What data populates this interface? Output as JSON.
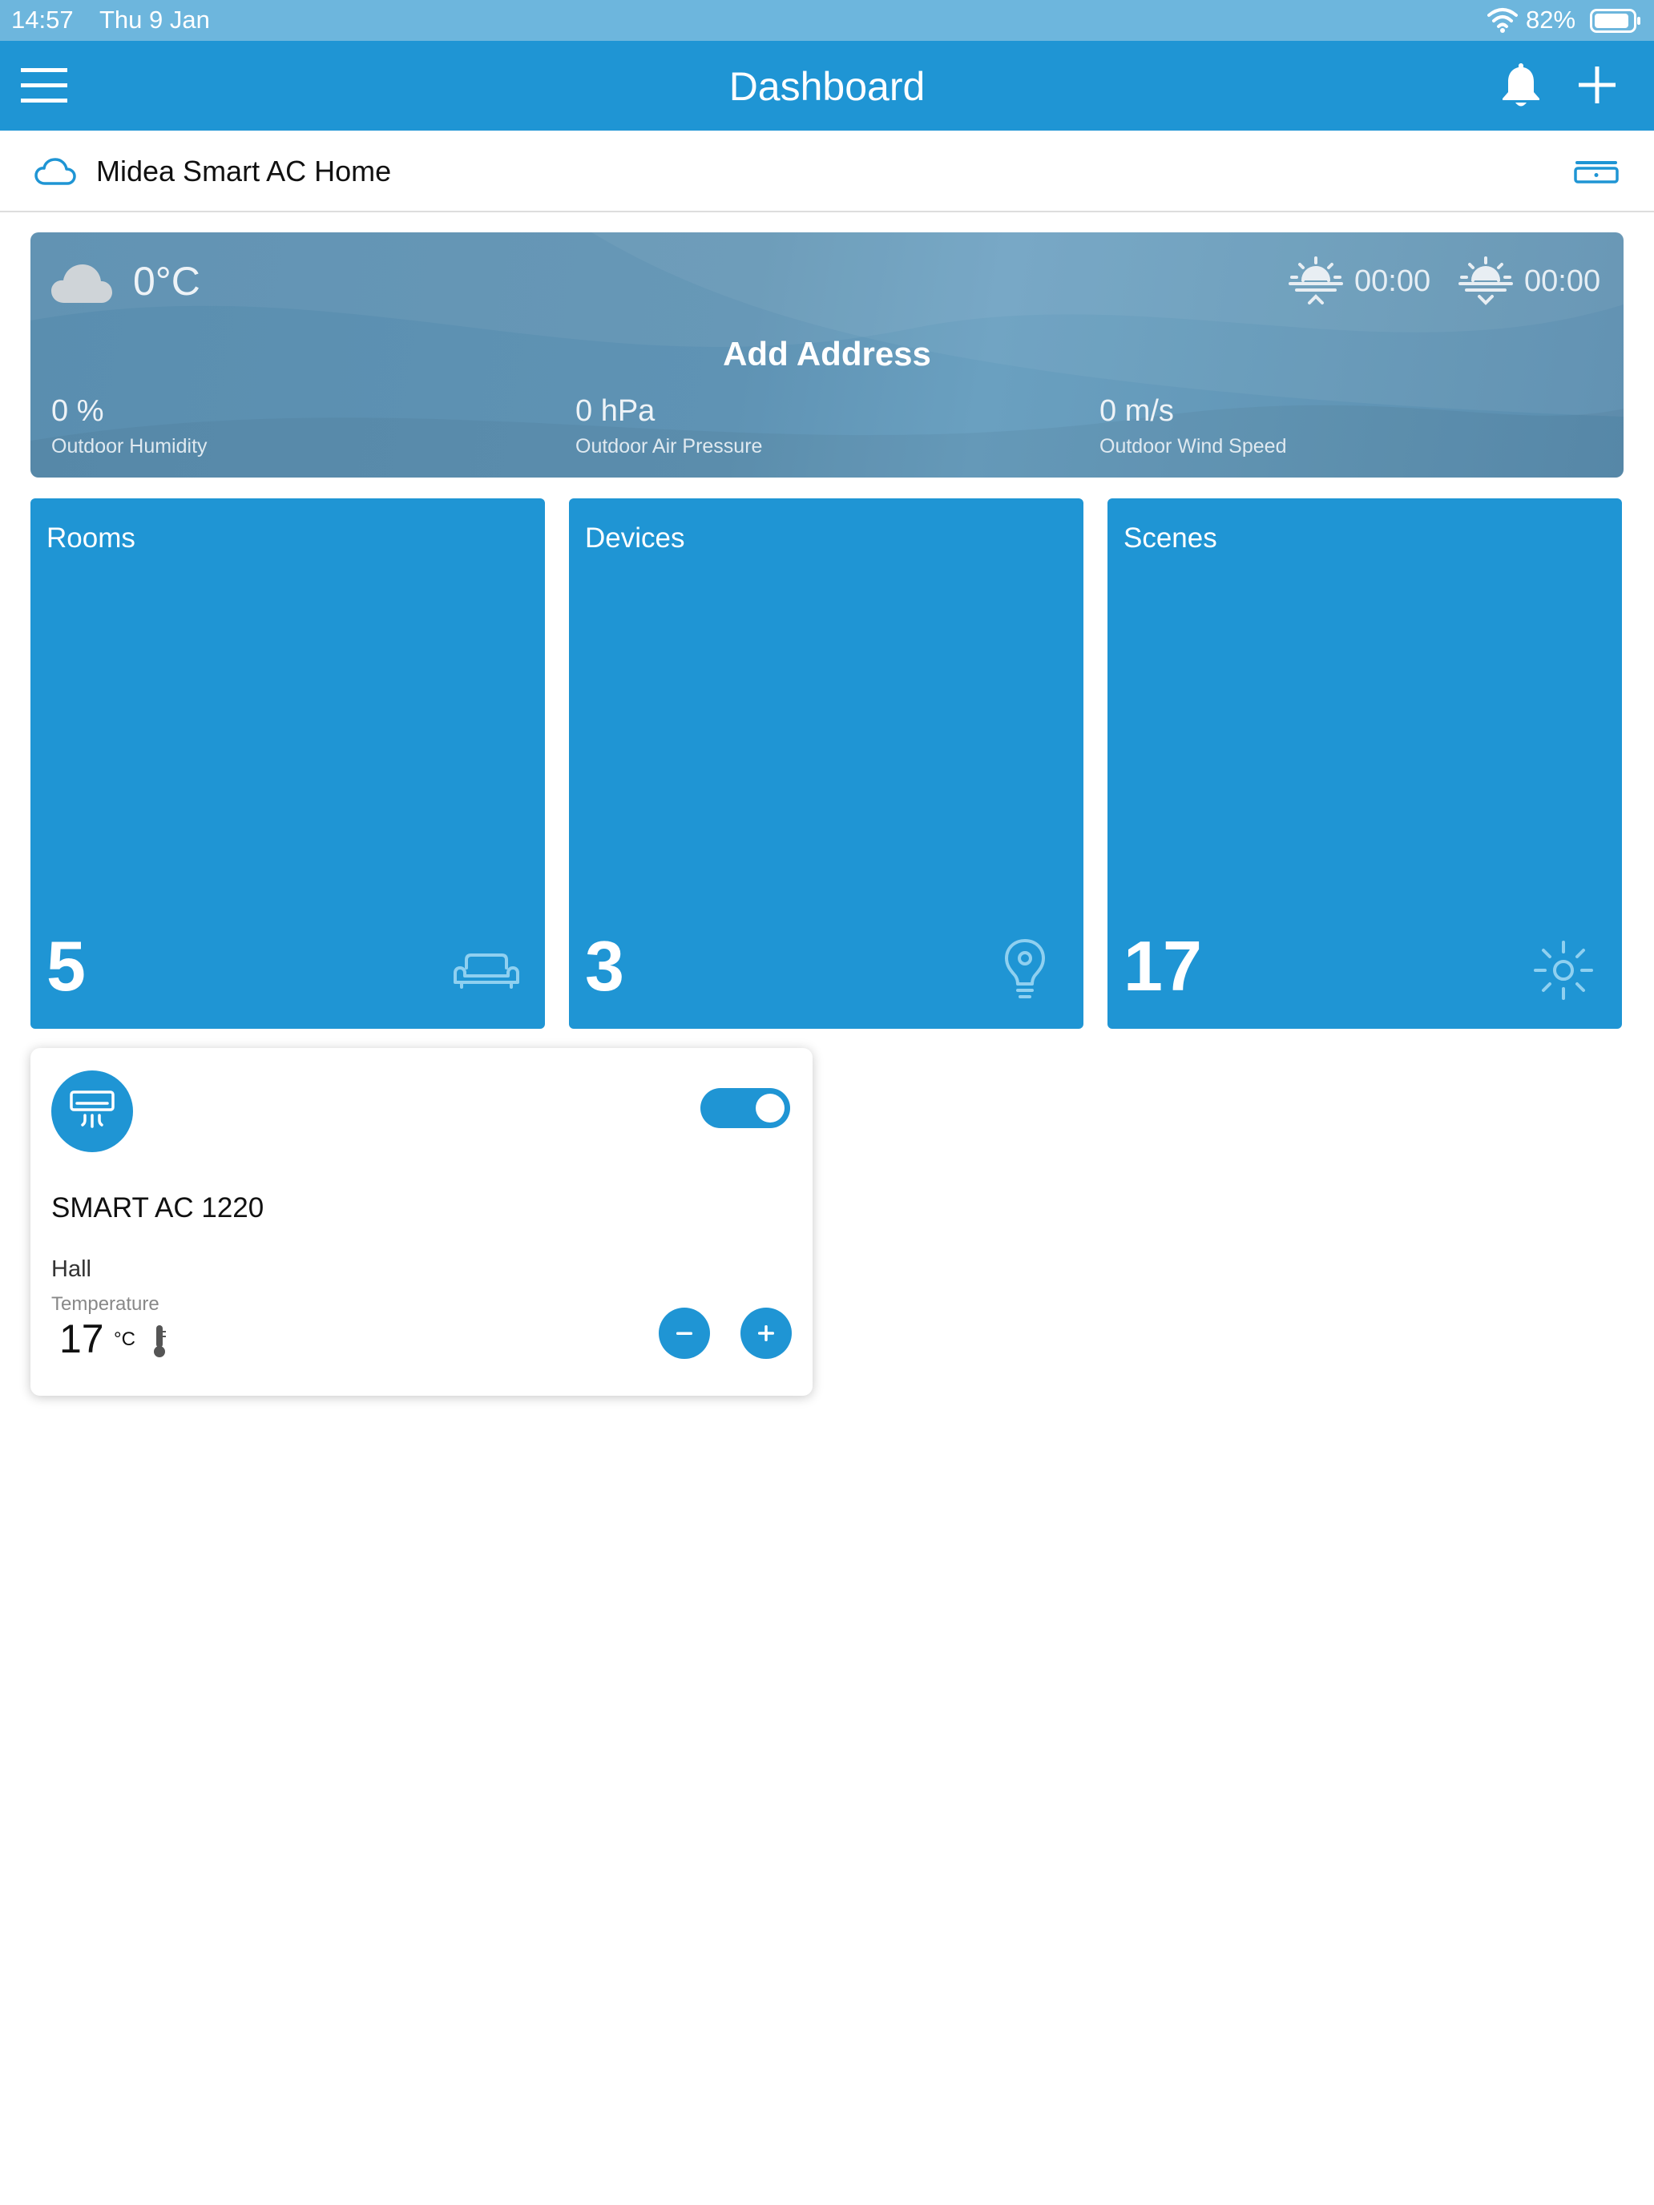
{
  "status_bar": {
    "time": "14:57",
    "date": "Thu 9 Jan",
    "battery": "82%"
  },
  "app_bar": {
    "title": "Dashboard"
  },
  "home": {
    "name": "Midea Smart AC Home"
  },
  "weather": {
    "temperature": "0°C",
    "sunrise": "00:00",
    "sunset": "00:00",
    "add_address": "Add Address",
    "stats": [
      {
        "value": "0 %",
        "label": "Outdoor Humidity"
      },
      {
        "value": "0 hPa",
        "label": "Outdoor Air Pressure"
      },
      {
        "value": "0 m/s",
        "label": "Outdoor Wind Speed"
      }
    ]
  },
  "tiles": [
    {
      "title": "Rooms",
      "count": "5",
      "icon": "sofa-icon"
    },
    {
      "title": "Devices",
      "count": "3",
      "icon": "lightbulb-icon"
    },
    {
      "title": "Scenes",
      "count": "17",
      "icon": "sun-icon"
    }
  ],
  "device": {
    "name": "SMART AC 1220",
    "room": "Hall",
    "temperature_label": "Temperature",
    "temperature_value": "17",
    "temperature_unit": "°C",
    "power_on": true
  },
  "colors": {
    "primary": "#1f95d4",
    "status_bar": "#6db6dd",
    "weather_card": "#5f93b4"
  }
}
